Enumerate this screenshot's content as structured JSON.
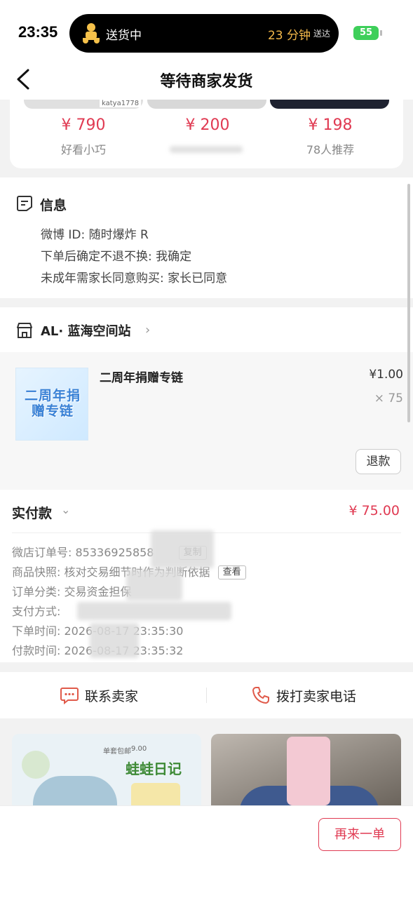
{
  "status_bar": {
    "time": "23:35",
    "delivery_label": "送货中",
    "eta_minutes": "23 分钟",
    "eta_suffix": "送达",
    "battery": "55"
  },
  "nav": {
    "title": "等待商家发货"
  },
  "recommendations_top": [
    {
      "price": "¥ 790",
      "subtitle": "好看小巧",
      "tag": "katya1778"
    },
    {
      "price": "¥ 200",
      "subtitle": ""
    },
    {
      "price": "¥ 198",
      "subtitle": "78人推荐"
    }
  ],
  "info": {
    "title": "信息",
    "lines": [
      "微博 ID: 随时爆炸 R",
      "下单后确定不退不换: 我确定",
      "未成年需家长同意购买: 家长已同意"
    ]
  },
  "shop": {
    "name": "AL· 蓝海空间站",
    "item": {
      "title": "二周年捐赠专链",
      "thumb_text": "二周年捐赠专链",
      "price": "¥1.00",
      "qty": "× 75"
    },
    "refund_label": "退款"
  },
  "payment": {
    "label": "实付款",
    "amount": "¥ 75.00",
    "details": [
      {
        "label": "微店订单号:",
        "value": "85336925858",
        "button": "复制"
      },
      {
        "label": "商品快照:",
        "value": "核对交易细节时作为判断依据",
        "button": "查看"
      },
      {
        "label": "订单分类:",
        "value": "交易资金担保",
        "button": ""
      },
      {
        "label": "支付方式:",
        "value": "",
        "button": ""
      },
      {
        "label": "下单时间:",
        "value": "2026-08-17 23:35:30",
        "button": ""
      },
      {
        "label": "付款时间:",
        "value": "2026-08-17 23:35:32",
        "button": ""
      }
    ]
  },
  "contact": {
    "chat_label": "联系卖家",
    "call_label": "拨打卖家电话"
  },
  "recommendations_bottom": {
    "left_title": "蛙蛙日记",
    "left_tag1": "单套包邮",
    "left_tag2": "9.00"
  },
  "bottom_bar": {
    "again_label": "再来一单"
  },
  "colors": {
    "accent": "#e03a52",
    "battery": "#3ecf5a"
  }
}
